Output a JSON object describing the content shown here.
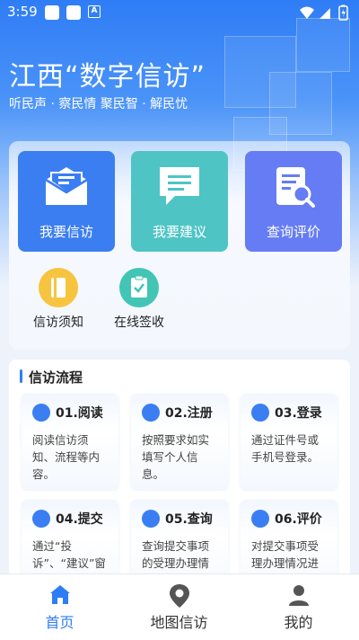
{
  "status_bar": {
    "time": "3:59",
    "a_label": "A"
  },
  "header": {
    "title": "江西“数字信访”",
    "subtitle": "听民声 · 察民情 聚民智 · 解民忧"
  },
  "main_actions": [
    {
      "label": "我要信访",
      "icon": "envelope-icon"
    },
    {
      "label": "我要建议",
      "icon": "chat-bubble-icon"
    },
    {
      "label": "查询评价",
      "icon": "document-search-icon"
    }
  ],
  "secondary_actions": [
    {
      "label": "信访须知",
      "icon": "book-icon"
    },
    {
      "label": "在线签收",
      "icon": "clipboard-check-icon"
    }
  ],
  "process": {
    "title": "信访流程",
    "steps": [
      {
        "title": "01.阅读",
        "desc": "阅读信访须知、流程等内容。",
        "icon": "map-icon"
      },
      {
        "title": "02.注册",
        "desc": "按照要求如实填写个人信息。",
        "icon": "user-add-icon"
      },
      {
        "title": "03.登录",
        "desc": "通过证件号或手机号登录。",
        "icon": "user-icon"
      },
      {
        "title": "04.提交",
        "desc": "通过“投诉”、“建议”窗口提交诉求。",
        "icon": "shield-check-icon"
      },
      {
        "title": "05.查询",
        "desc": "查询提交事项的受理办理情况。",
        "icon": "search-icon"
      },
      {
        "title": "06.评价",
        "desc": "对提交事项受理办理情况进行评价。",
        "icon": "comment-icon"
      }
    ]
  },
  "bottom_nav": [
    {
      "label": "首页",
      "icon": "home-icon",
      "active": true
    },
    {
      "label": "地图信访",
      "icon": "map-pin-icon",
      "active": false
    },
    {
      "label": "我的",
      "icon": "person-icon",
      "active": false
    }
  ],
  "colors": {
    "primary": "#2f7df6",
    "teal": "#4fc4c4",
    "indigo": "#667cf5",
    "yellow": "#f7c440"
  }
}
